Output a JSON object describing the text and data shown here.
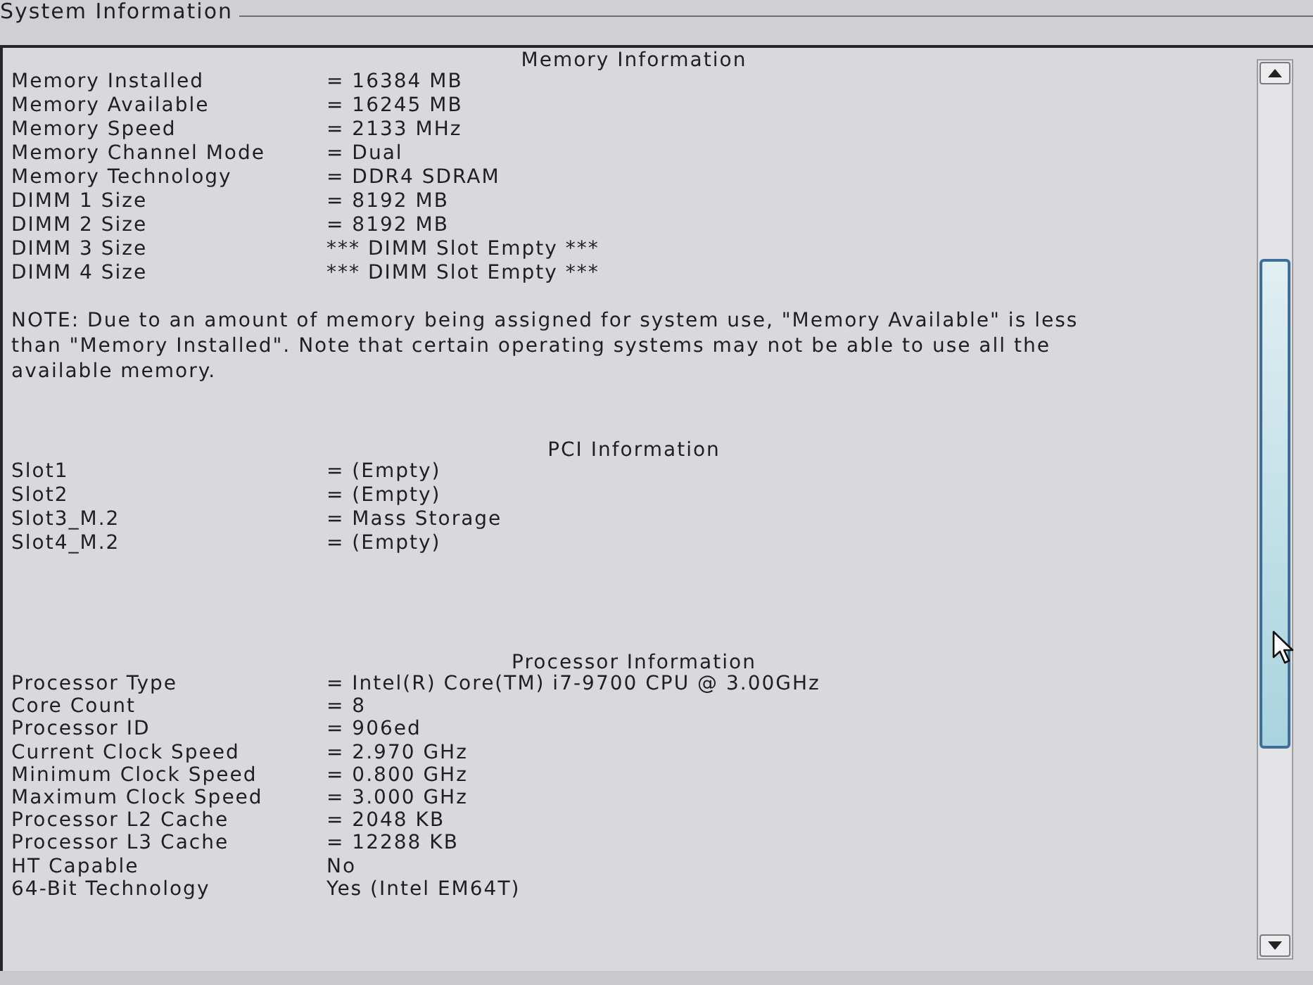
{
  "window": {
    "title": "System Information"
  },
  "sections": [
    {
      "title": "Memory Information",
      "rows": [
        {
          "label": "Memory Installed",
          "value": "= 16384 MB"
        },
        {
          "label": "Memory Available",
          "value": "= 16245 MB"
        },
        {
          "label": "Memory Speed",
          "value": "= 2133 MHz"
        },
        {
          "label": "Memory Channel Mode",
          "value": "= Dual"
        },
        {
          "label": "Memory Technology",
          "value": "= DDR4 SDRAM"
        },
        {
          "label": "DIMM 1 Size",
          "value": "= 8192 MB"
        },
        {
          "label": "DIMM 2 Size",
          "value": "= 8192 MB"
        },
        {
          "label": "DIMM 3 Size",
          "value": "*** DIMM Slot Empty ***"
        },
        {
          "label": "DIMM 4 Size",
          "value": "*** DIMM Slot Empty ***"
        }
      ],
      "note": "NOTE: Due to an amount of memory being assigned for system use, \"Memory Available\" is less than \"Memory Installed\". Note that certain operating systems may not be able to use all the available memory."
    },
    {
      "title": "PCI Information",
      "rows": [
        {
          "label": "Slot1",
          "value": "= (Empty)"
        },
        {
          "label": "Slot2",
          "value": "= (Empty)"
        },
        {
          "label": "Slot3_M.2",
          "value": "= Mass Storage"
        },
        {
          "label": "Slot4_M.2",
          "value": "= (Empty)"
        }
      ]
    },
    {
      "title": "Processor Information",
      "rows": [
        {
          "label": "Processor Type",
          "value": "= Intel(R) Core(TM) i7-9700 CPU @ 3.00GHz"
        },
        {
          "label": "Core Count",
          "value": "= 8"
        },
        {
          "label": "Processor ID",
          "value": "= 906ed"
        },
        {
          "label": "Current Clock Speed",
          "value": "= 2.970 GHz"
        },
        {
          "label": "Minimum Clock Speed",
          "value": "= 0.800 GHz"
        },
        {
          "label": "Maximum Clock Speed",
          "value": "= 3.000 GHz"
        },
        {
          "label": "Processor L2 Cache",
          "value": "= 2048 KB"
        },
        {
          "label": "Processor L3 Cache",
          "value": "= 12288 KB"
        },
        {
          "label": "HT Capable",
          "value": "No"
        },
        {
          "label": "64-Bit Technology",
          "value": "Yes (Intel EM64T)"
        }
      ]
    }
  ]
}
